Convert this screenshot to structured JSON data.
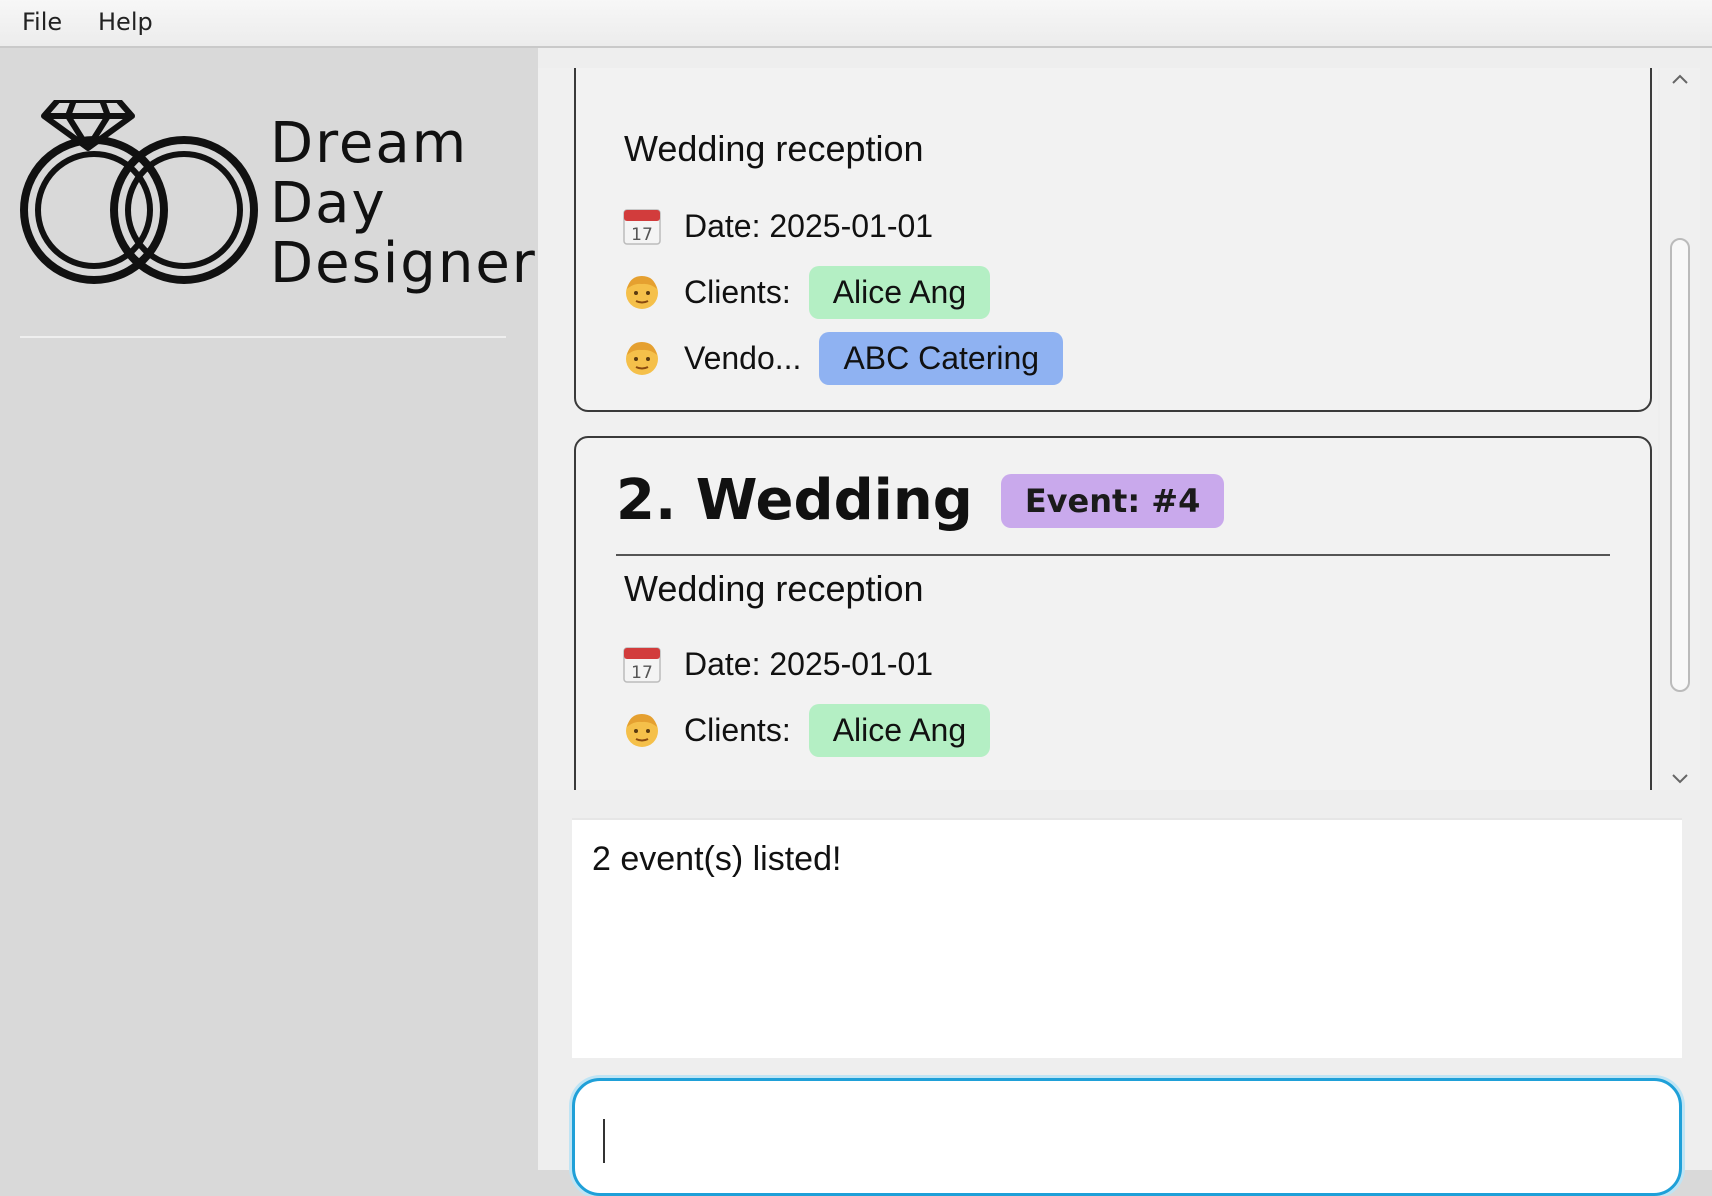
{
  "menu": {
    "file": "File",
    "help": "Help"
  },
  "brand": {
    "line1": "Dream",
    "line2": "Day",
    "line3": "Designer"
  },
  "events": [
    {
      "description": "Wedding reception",
      "date_label": "Date: 2025-01-01",
      "clients_label": "Clients:",
      "clients": [
        "Alice Ang"
      ],
      "vendors_label": "Vendo...",
      "vendors": [
        "ABC Catering"
      ]
    },
    {
      "title": "2. Wedding",
      "badge": "Event: #4",
      "description": "Wedding reception",
      "date_label": "Date: 2025-01-01",
      "clients_label": "Clients:",
      "clients": [
        "Alice Ang"
      ]
    }
  ],
  "result": {
    "message": "2 event(s) listed!"
  },
  "command": {
    "value": ""
  },
  "icons": {
    "calendar": "calendar-icon",
    "person": "person-icon",
    "logo": "rings-logo"
  },
  "colors": {
    "client_pill": "#b4efc4",
    "vendor_pill": "#8fb2f2",
    "event_badge": "#c9a9ec",
    "input_focus": "#1fa0d8"
  }
}
